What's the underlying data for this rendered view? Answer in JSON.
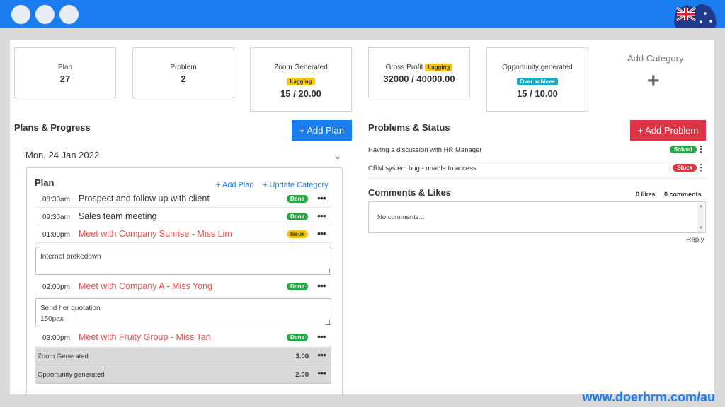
{
  "colors": {
    "accent": "#1b7cf0",
    "danger": "#dc3545",
    "success": "#28a745",
    "warning": "#f7c31a",
    "info": "#1aa8c6"
  },
  "window": {
    "controls": [
      "dot",
      "dot",
      "dot"
    ],
    "flag_icon": "australia-flag-icon"
  },
  "summary_cards": [
    {
      "label": "Plan",
      "value": "27"
    },
    {
      "label": "Problem",
      "value": "2"
    },
    {
      "label": "Zoom Generated",
      "badge": "Lagging",
      "value": "15 / 20.00"
    },
    {
      "label": "Gross Profit",
      "badge": "Lagging",
      "value": "32000 / 40000.00"
    },
    {
      "label": "Opportunity generated",
      "badge": "Over achieve",
      "value": "15 / 10.00"
    }
  ],
  "add_category": {
    "label": "Add Category",
    "icon": "plus-icon",
    "symbol": "+"
  },
  "plans": {
    "title": "Plans & Progress",
    "add_button": "+ Add Plan",
    "date": "Mon, 24 Jan 2022",
    "box_title": "Plan",
    "add_link": "+ Add Plan",
    "update_link": "+ Update Category",
    "items": [
      {
        "time": "08:30am",
        "title": "Prospect and follow up with client",
        "status": "Done"
      },
      {
        "time": "09:30am",
        "title": "Sales team meeting",
        "status": "Done"
      },
      {
        "time": "01:00pm",
        "title": "Meet with Company Sunrise - Miss Lim",
        "status": "Issue"
      },
      {
        "time": "02:00pm",
        "title": "Meet with Company A - Miss Yong",
        "status": "Done"
      },
      {
        "time": "03:00pm",
        "title": "Meet with Fruity Group - Miss Tan",
        "status": "Done"
      }
    ],
    "notes": [
      {
        "line1": "Internet brokedown",
        "line2": ""
      },
      {
        "line1": "Send her quotation",
        "line2": "150pax"
      }
    ],
    "metrics": [
      {
        "label": "Zoom Generated",
        "value": "3.00"
      },
      {
        "label": "Opportunity generated",
        "value": "2.00"
      }
    ]
  },
  "problems": {
    "title": "Problems & Status",
    "add_button": "+ Add Problem",
    "items": [
      {
        "text": "Having a discussion with HR Manager",
        "status": "Solved"
      },
      {
        "text": "CRM system bug - unable to access",
        "status": "Stuck"
      }
    ]
  },
  "comments": {
    "title": "Comments & Likes",
    "likes": "0 likes",
    "count": "0 comments",
    "placeholder": "No comments...",
    "reply": "Reply"
  },
  "footer": {
    "url": "www.doerhrm.com/au"
  }
}
